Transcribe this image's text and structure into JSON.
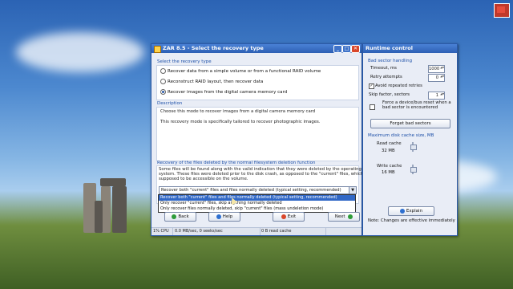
{
  "main_window": {
    "title": "ZAR 8.5 - Select the recovery type",
    "recovery_type": {
      "label": "Select the recovery type",
      "options": [
        "Recover data from a simple volume or from a functional RAID volume",
        "Reconstruct RAID layout, then recover data",
        "Recover images from the digital camera memory card"
      ],
      "selected_index": 2
    },
    "description": {
      "label": "Description",
      "line1": "Choose this mode to recover images from a digital camera memory card",
      "line2": "This recovery mode is specifically tailored to recover photographic images."
    },
    "deleted_files": {
      "label": "Recovery of the files deleted by the normal filesystem deletion function",
      "text1": "Some files will be found along with the valid indication that they were deleted by the operating",
      "text2": "system. These files were deleted prior to the disk crash, as opposed to the \"current\" files, which are",
      "text3": "supposed to be accessible on the volume.",
      "selected": "Recover both \"current\" files and files normally deleted (typical setting, recommended)",
      "options": [
        "Recover both \"current\" files and files normally deleted (typical setting, recommended)",
        "Only recover \"current\" files, skip anything normally deleted",
        "Only recover files normally deleted, skip \"current\" files (mass undeletion mode)"
      ]
    },
    "buttons": {
      "back": "Back",
      "help": "Help",
      "exit": "Exit",
      "next": "Next"
    },
    "status": {
      "cpu": "1% CPU",
      "io": "0.0 MB/sec, 0 seeks/sec",
      "cache": "0 B read cache"
    }
  },
  "runtime_window": {
    "title": "Runtime control",
    "bad_sector": {
      "label": "Bad sector handling",
      "timeout_label": "Timeout, ms",
      "timeout_value": "1000",
      "retry_label": "Retry attempts",
      "retry_value": "0",
      "avoid_label": "Avoid repeated retries",
      "avoid_checked": true,
      "skip_label": "Skip factor, sectors",
      "skip_value": "1",
      "force_label_1": "Force a device/bus reset when a",
      "force_label_2": "bad sector is encountered",
      "force_checked": false,
      "forget_button": "Forget bad sectors"
    },
    "cache": {
      "label": "Maximum disk cache size, MB",
      "read_label": "Read cache",
      "read_value": "32 MB",
      "write_label": "Write cache",
      "write_value": "16 MB"
    },
    "explain_button": "Explain",
    "note": "Note: Changes are effective immediately"
  },
  "titlebar_buttons": {
    "minimize": "_",
    "maximize": "□",
    "close": "✕"
  },
  "colors": {
    "accent": "#2d5fb4",
    "selection": "#3168c6",
    "group_label": "#1c4fa8"
  }
}
